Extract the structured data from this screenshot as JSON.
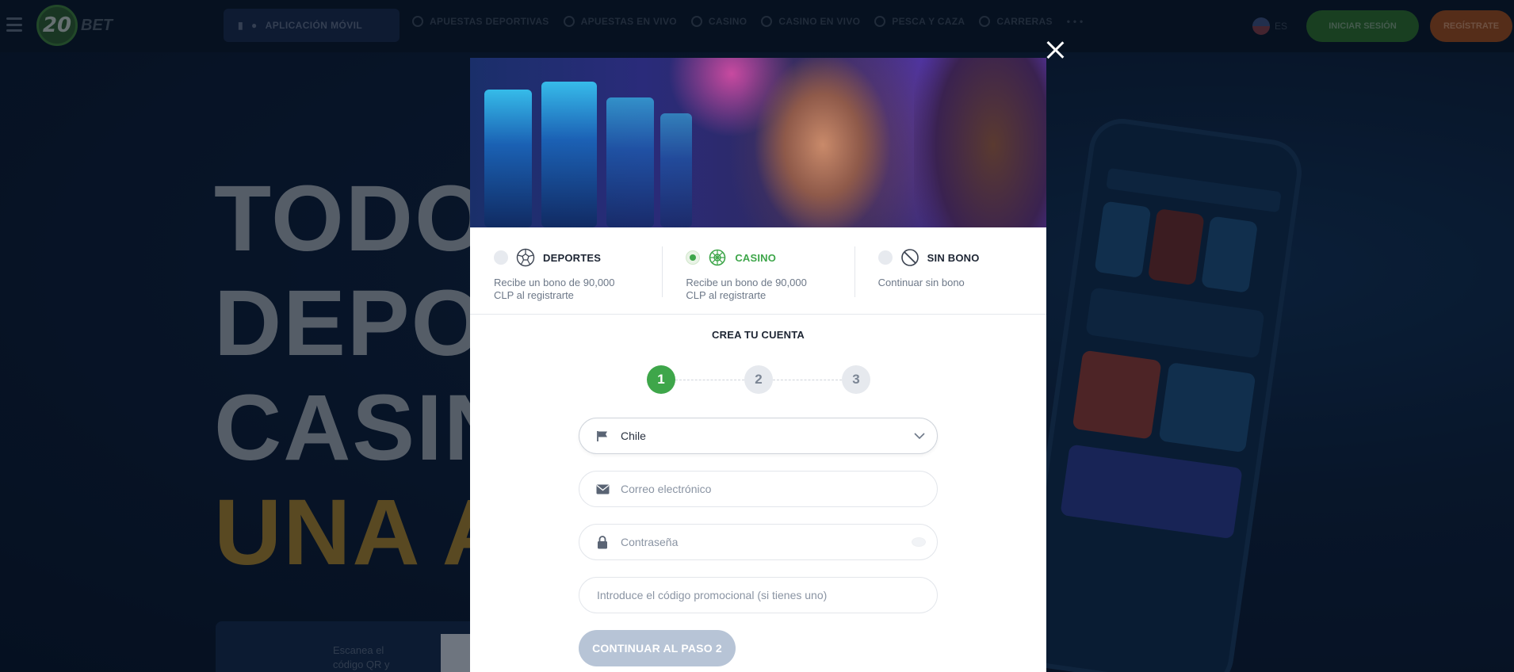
{
  "site": {
    "logo_number": "20",
    "logo_text": "BET",
    "app_button": "APLICACIÓN MÓVIL",
    "nav_items": [
      "APUESTAS DEPORTIVAS",
      "APUESTAS EN VIVO",
      "CASINO",
      "CASINO EN VIVO",
      "PESCA Y CAZA",
      "CARRERAS",
      "• • •"
    ],
    "language": "ES",
    "login_button": "INICIAR SESIÓN",
    "register_button": "REGÍSTRATE",
    "hero_lines": [
      "TODO",
      "DEPO",
      "CASIN"
    ],
    "hero_accent_line": "UNA A",
    "qr_text_lines": [
      "Escanea el",
      "código QR y"
    ],
    "colors": {
      "green": "#3ea64a",
      "orange": "#e8711f",
      "navy": "#0a1628"
    }
  },
  "modal": {
    "close_icon": "close-icon",
    "bonus_options": [
      {
        "title": "DEPORTES",
        "desc": "Recibe un bono de 90,000 CLP al registrarte",
        "selected": false,
        "icon": "soccer-ball-icon"
      },
      {
        "title": "CASINO",
        "desc": "Recibe un bono de 90,000 CLP al registrarte",
        "selected": true,
        "icon": "slot-machine-icon"
      },
      {
        "title": "SIN BONO",
        "desc": "Continuar sin bono",
        "selected": false,
        "icon": "no-bonus-icon"
      }
    ],
    "form_title": "CREA TU CUENTA",
    "steps": [
      "1",
      "2",
      "3"
    ],
    "active_step": 1,
    "country": {
      "value": "Chile",
      "icon": "flag-icon"
    },
    "email": {
      "placeholder": "Correo electrónico",
      "value": "",
      "icon": "envelope-icon"
    },
    "password": {
      "placeholder": "Contraseña",
      "value": "",
      "icon": "lock-icon"
    },
    "promo": {
      "placeholder": "Introduce el código promocional (si tienes uno)",
      "value": ""
    },
    "continue_button": "CONTINUAR AL PASO 2",
    "accent_color": "#3ea64a",
    "button_disabled_color": "#b7c4d6"
  }
}
